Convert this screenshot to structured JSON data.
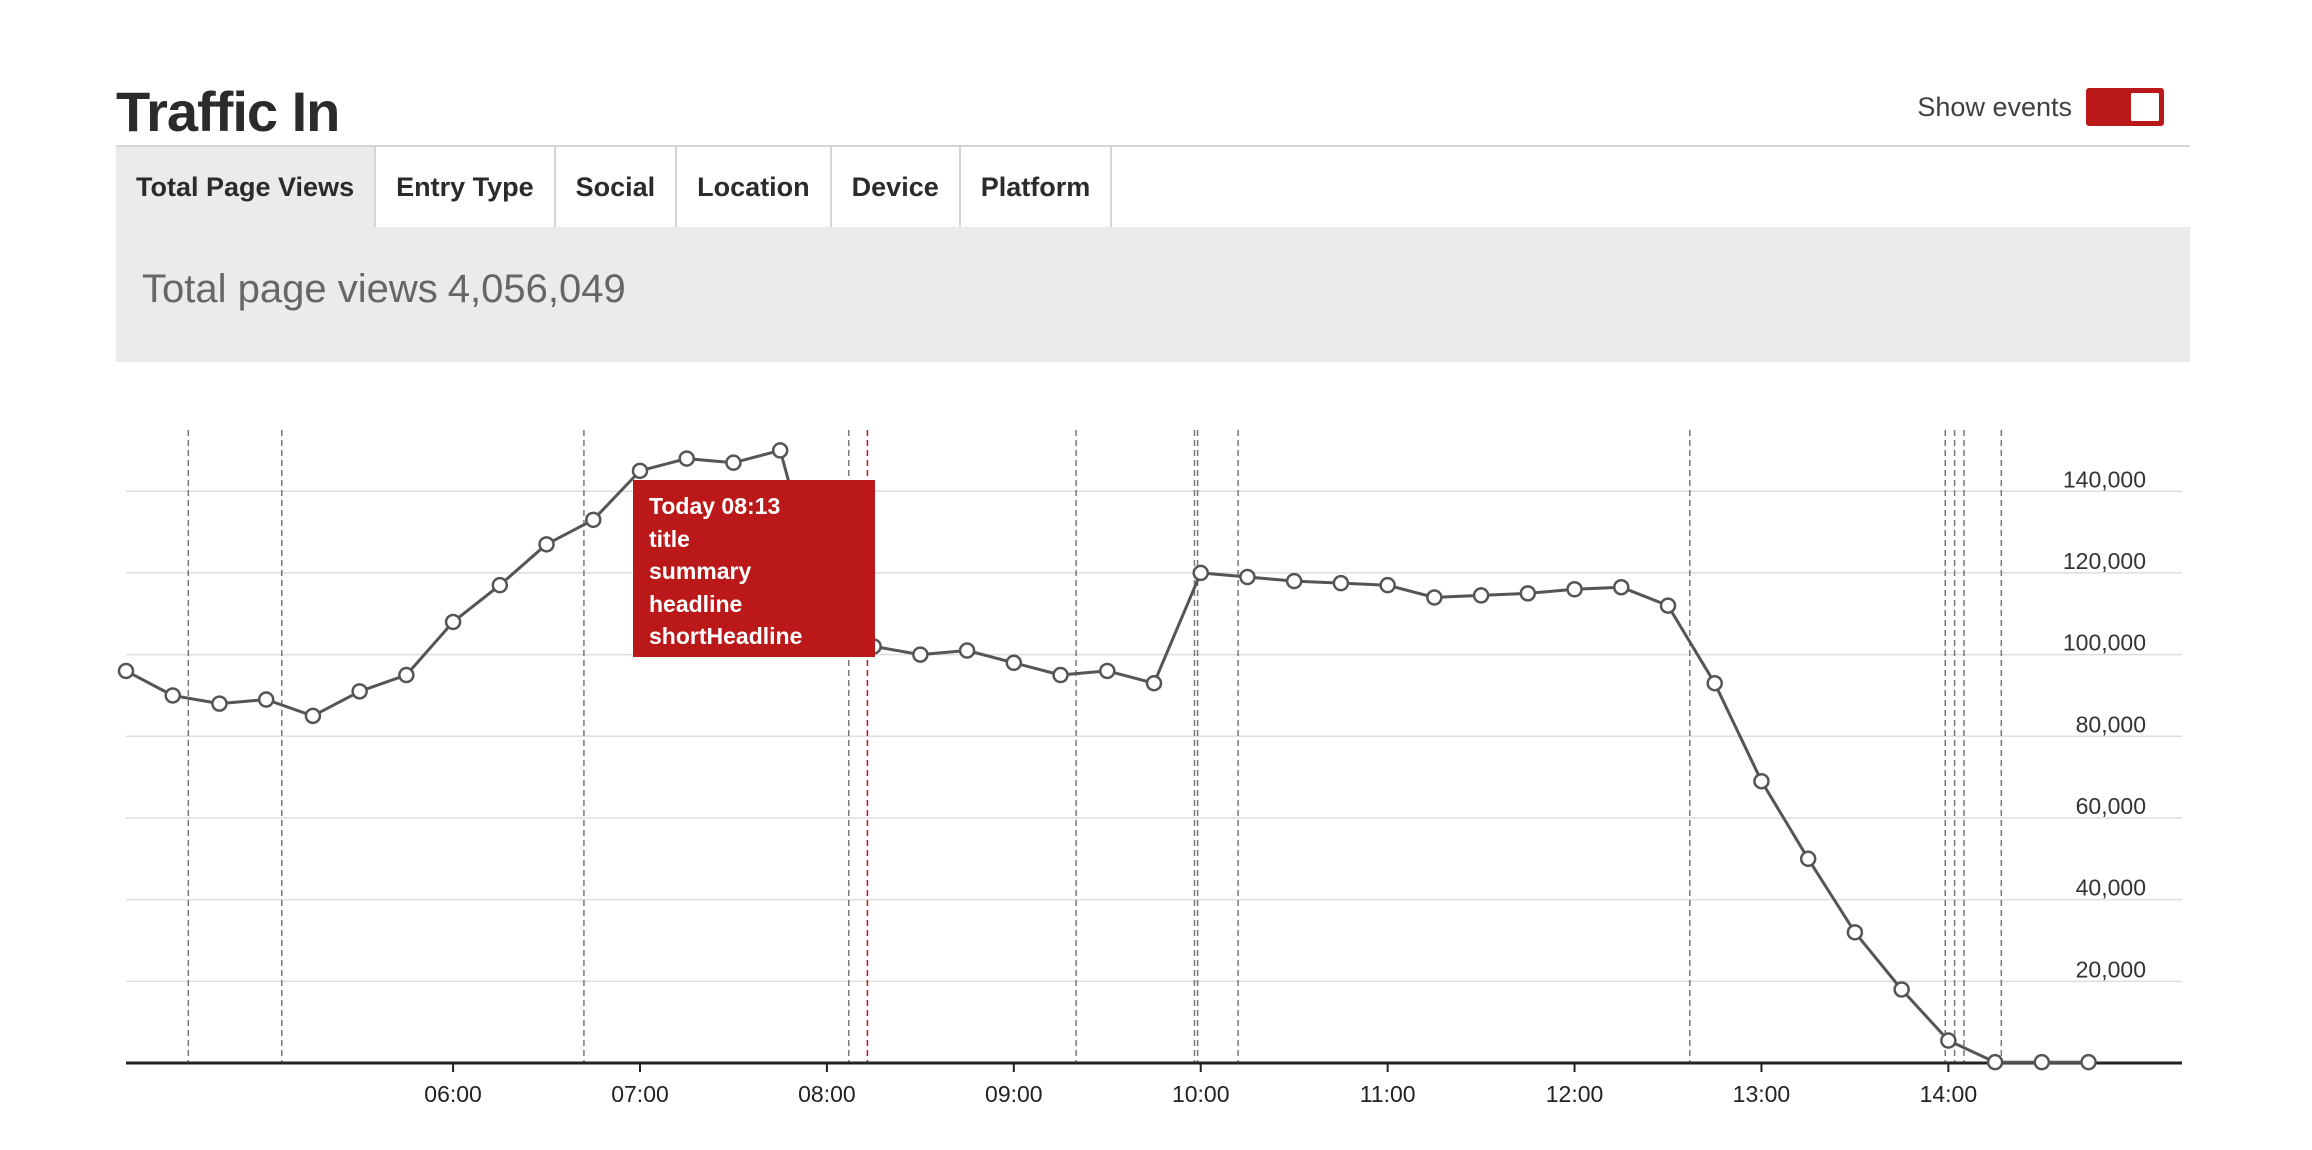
{
  "header": {
    "title": "Traffic In",
    "events_label": "Show events",
    "events_on": true
  },
  "tabs": [
    {
      "label": "Total Page Views",
      "active": true
    },
    {
      "label": "Entry Type",
      "active": false
    },
    {
      "label": "Social",
      "active": false
    },
    {
      "label": "Location",
      "active": false
    },
    {
      "label": "Device",
      "active": false
    },
    {
      "label": "Platform",
      "active": false
    }
  ],
  "summary": {
    "label": "Total page views",
    "value": "4,056,049"
  },
  "tooltip": {
    "time": "Today 08:13",
    "lines": [
      "title",
      "summary",
      "headline",
      "shortHeadline"
    ]
  },
  "colors": {
    "accent": "#bb1919",
    "line": "#555555",
    "grid": "#dddddd",
    "panel": "#ebebec"
  },
  "chart_data": {
    "type": "line",
    "title": "",
    "xlabel": "",
    "ylabel": "",
    "x_ticks": [
      "06:00",
      "07:00",
      "08:00",
      "09:00",
      "10:00",
      "11:00",
      "12:00",
      "13:00",
      "14:00"
    ],
    "y_ticks": [
      "20,000",
      "40,000",
      "60,000",
      "80,000",
      "100,000",
      "120,000",
      "140,000"
    ],
    "xlim": [
      "04:15",
      "15:15"
    ],
    "ylim": [
      0,
      155000
    ],
    "grid": "horizontal",
    "series": [
      {
        "x": [
          "04:15",
          "04:30",
          "04:45",
          "05:00",
          "05:15",
          "05:30",
          "05:45",
          "06:00",
          "06:15",
          "06:30",
          "06:45",
          "07:00",
          "07:15",
          "07:30",
          "07:45",
          "08:00",
          "08:15",
          "08:30",
          "08:45",
          "09:00",
          "09:15",
          "09:30",
          "09:45",
          "10:00",
          "10:15",
          "10:30",
          "10:45",
          "11:00",
          "11:15",
          "11:30",
          "11:45",
          "12:00",
          "12:15",
          "12:30",
          "12:45",
          "13:00",
          "13:15",
          "13:30",
          "13:45",
          "14:00",
          "14:15",
          "14:30",
          "14:45"
        ],
        "values": [
          96000,
          90000,
          88000,
          89000,
          85000,
          91000,
          95000,
          108000,
          117000,
          127000,
          133000,
          145000,
          148000,
          147000,
          150000,
          108000,
          102000,
          100000,
          101000,
          98000,
          95000,
          96000,
          93000,
          120000,
          119000,
          118000,
          117500,
          117000,
          114000,
          114500,
          115000,
          116000,
          116500,
          112000,
          93000,
          69000,
          50000,
          32000,
          18000,
          5500,
          200,
          200,
          200
        ]
      }
    ],
    "events": [
      "04:35",
      "05:05",
      "06:42",
      "08:07",
      "08:13",
      "09:20",
      "09:58",
      "09:59",
      "10:12",
      "12:37",
      "13:59",
      "14:02",
      "14:05",
      "14:17"
    ],
    "highlighted_event": "08:13"
  }
}
